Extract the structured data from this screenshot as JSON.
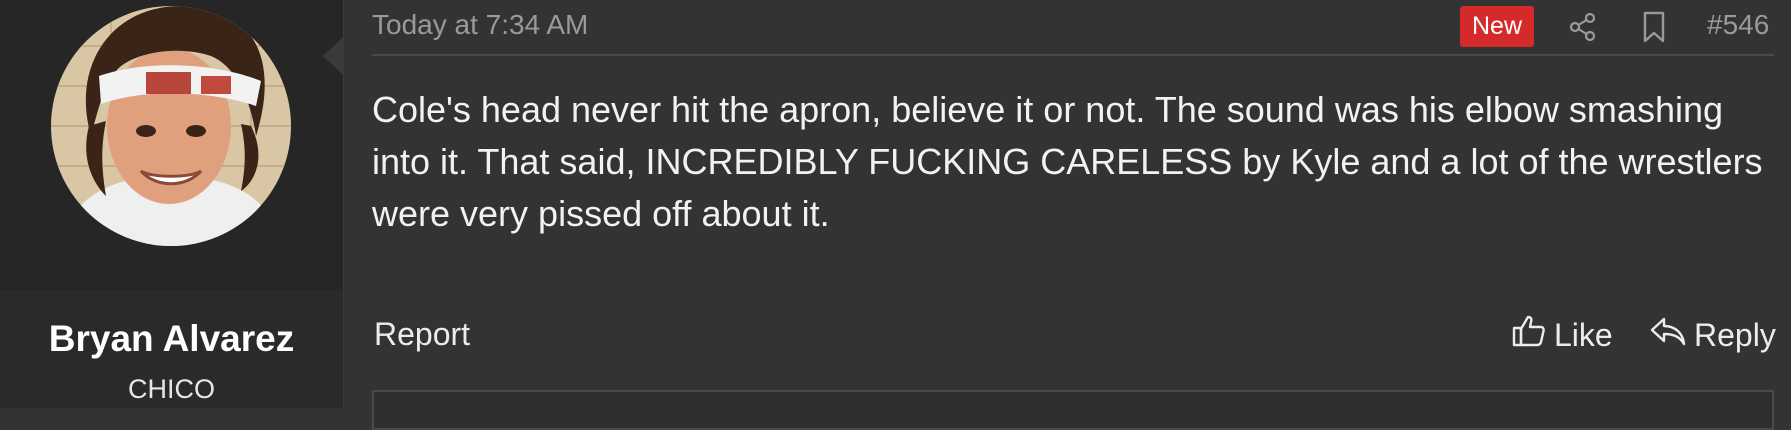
{
  "user": {
    "name": "Bryan Alvarez",
    "title": "CHICO"
  },
  "post": {
    "timestamp": "Today at 7:34 AM",
    "badge": "New",
    "number": "#546",
    "body": "Cole's head never hit the apron, believe it or not. The sound was his elbow smashing into it. That said, INCREDIBLY FUCKING CARELESS by Kyle and a lot of the wrestlers were very pissed off about it."
  },
  "actions": {
    "report": "Report",
    "like": "Like",
    "reply": "Reply"
  },
  "icons": {
    "share": "share-icon",
    "bookmark": "bookmark-icon",
    "like": "thumbs-up-icon",
    "reply": "reply-icon"
  },
  "colors": {
    "background": "#333333",
    "sidebar": "#2a2a2a",
    "badge_new": "#d42a2a",
    "muted_text": "#9a9a9a"
  }
}
